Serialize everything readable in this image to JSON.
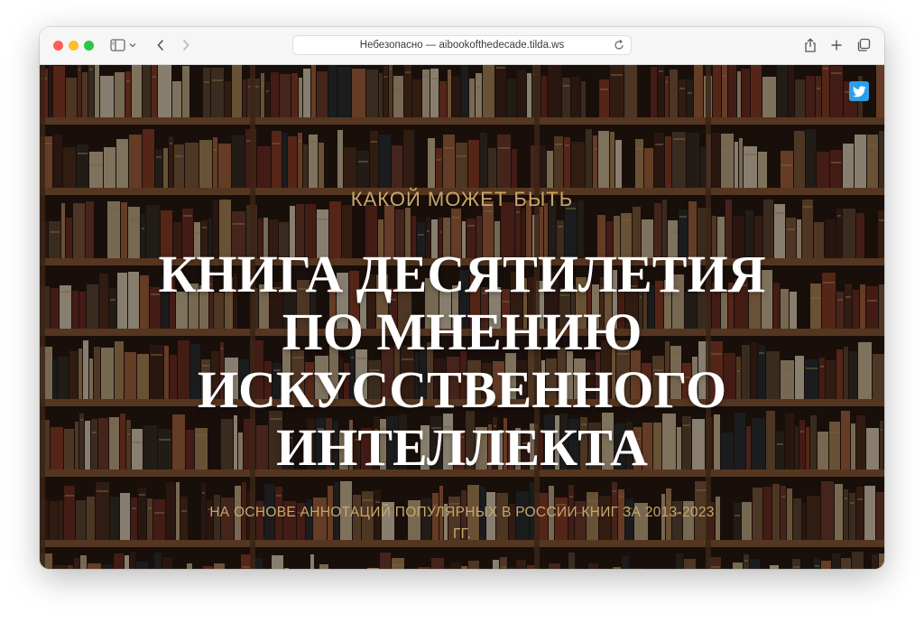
{
  "browser": {
    "address_text": "Небезопасно — aibookofthedecade.tilda.ws",
    "icons": [
      "sidebar-icon",
      "chevron-down-icon",
      "back-icon",
      "forward-icon",
      "reload-icon",
      "share-icon",
      "plus-icon",
      "tabs-icon"
    ]
  },
  "page": {
    "eyebrow": "КАКОЙ МОЖЕТ БЫТЬ",
    "headline_lines": [
      "КНИГА ДЕСЯТИЛЕТИЯ",
      "ПО МНЕНИЮ",
      "ИСКУССТВЕННОГО",
      "ИНТЕЛЛЕКТА"
    ],
    "subtitle": "НА ОСНОВЕ АННОТАЦИЙ ПОПУЛЯРНЫХ В РОССИИ КНИГ ЗА 2013-2023 ГГ.",
    "social_icon": "twitter-icon"
  },
  "colors": {
    "accent_gold": "#c9a76b",
    "headline": "#ffffff",
    "twitter": "#2b9fea",
    "traffic_red": "#fe5f57",
    "traffic_yellow": "#febc2e",
    "traffic_green": "#28c840"
  }
}
